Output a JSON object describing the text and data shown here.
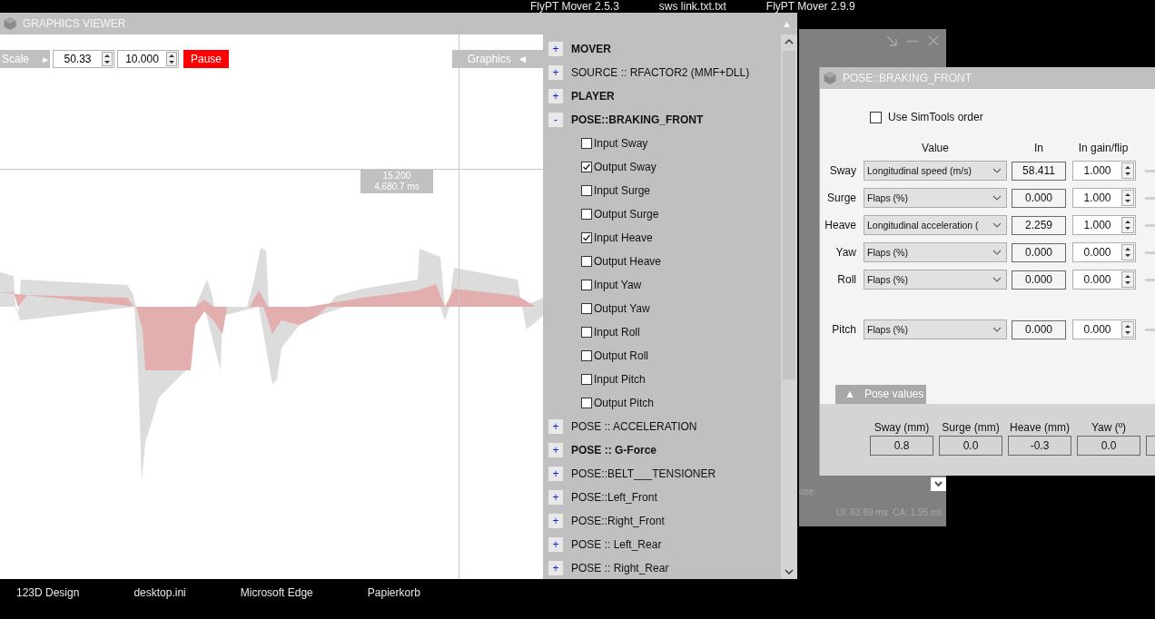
{
  "desktop": {
    "top_labels": [
      "FlyPT Mover 2.5.3",
      "sws link.txt.txt",
      "FlyPT Mover 2.9.9"
    ],
    "bottom_labels": [
      "123D Design",
      "desktop.ini",
      "Microsoft Edge",
      "Papierkorb"
    ]
  },
  "graphics_viewer": {
    "title": "GRAPHICS VIEWER",
    "collapse_glyph": "▲",
    "toolbar": {
      "scale_label": "Scale",
      "scale_glyph": "►",
      "scale_value": "50.33",
      "range_value": "10.000",
      "pause_button": "Pause",
      "graphics_label": "Graphics",
      "graphics_glyph": "◄"
    },
    "cursor": {
      "value": "15.200",
      "time": "4,680.7 ms"
    },
    "tree": [
      {
        "label": "MOVER",
        "toggle": "+",
        "bold": true
      },
      {
        "label": "SOURCE :: RFACTOR2 (MMF+DLL)",
        "toggle": "+",
        "bold": false
      },
      {
        "label": "PLAYER",
        "toggle": "+",
        "bold": true
      },
      {
        "label": "POSE::BRAKING_FRONT",
        "toggle": "-",
        "bold": true,
        "children": [
          {
            "label": "Input Sway",
            "checked": false
          },
          {
            "label": "Output Sway",
            "checked": true
          },
          {
            "label": "Input Surge",
            "checked": false
          },
          {
            "label": "Output Surge",
            "checked": false
          },
          {
            "label": "Input Heave",
            "checked": true
          },
          {
            "label": "Output Heave",
            "checked": false
          },
          {
            "label": "Input Yaw",
            "checked": false
          },
          {
            "label": "Output Yaw",
            "checked": false
          },
          {
            "label": "Input Roll",
            "checked": false
          },
          {
            "label": "Output Roll",
            "checked": false
          },
          {
            "label": "Input Pitch",
            "checked": false
          },
          {
            "label": "Output Pitch",
            "checked": false
          }
        ]
      },
      {
        "label": "POSE :: ACCELERATION",
        "toggle": "+",
        "bold": false
      },
      {
        "label": "POSE :: G-Force",
        "toggle": "+",
        "bold": true
      },
      {
        "label": "POSE::BELT___TENSIONER",
        "toggle": "+",
        "bold": false
      },
      {
        "label": "POSE::Left_Front",
        "toggle": "+",
        "bold": false
      },
      {
        "label": "POSE::Right_Front",
        "toggle": "+",
        "bold": false
      },
      {
        "label": "POSE :: Left_Rear",
        "toggle": "+",
        "bold": false
      },
      {
        "label": "POSE :: Right_Rear",
        "toggle": "+",
        "bold": false
      }
    ]
  },
  "mover_window": {
    "mouse_label": "use:",
    "stats": "UI: 63.69 ms  CA: 1.95 ms"
  },
  "pose_window": {
    "title": "POSE::BRAKING_FRONT",
    "simtools_order": {
      "label": "Use SimTools order",
      "checked": false
    },
    "columns": [
      "Value",
      "In",
      "In gain/flip"
    ],
    "rows": [
      {
        "axis": "Sway",
        "value": "Longitudinal speed (m/s)",
        "in": "58.411",
        "gain": "1.000"
      },
      {
        "axis": "Surge",
        "value": "Flaps (%)",
        "in": "0.000",
        "gain": "1.000"
      },
      {
        "axis": "Heave",
        "value": "Longitudinal acceleration (",
        "in": "2.259",
        "gain": "1.000"
      },
      {
        "axis": "Yaw",
        "value": "Flaps (%)",
        "in": "0.000",
        "gain": "0.000"
      },
      {
        "axis": "Roll",
        "value": "Flaps (%)",
        "in": "0.000",
        "gain": "0.000"
      }
    ],
    "lower_rows": [
      {
        "axis": "Pitch",
        "value": "Flaps (%)",
        "in": "0.000",
        "gain": "0.000"
      }
    ],
    "pose_values": {
      "tab": "Pose values",
      "tab_glyph": "▲",
      "fields": [
        {
          "label": "Sway (mm)",
          "value": "0.8"
        },
        {
          "label": "Surge (mm)",
          "value": "0.0"
        },
        {
          "label": "Heave (mm)",
          "value": "-0.3"
        },
        {
          "label": "Yaw (º)",
          "value": "0.0"
        }
      ]
    }
  }
}
